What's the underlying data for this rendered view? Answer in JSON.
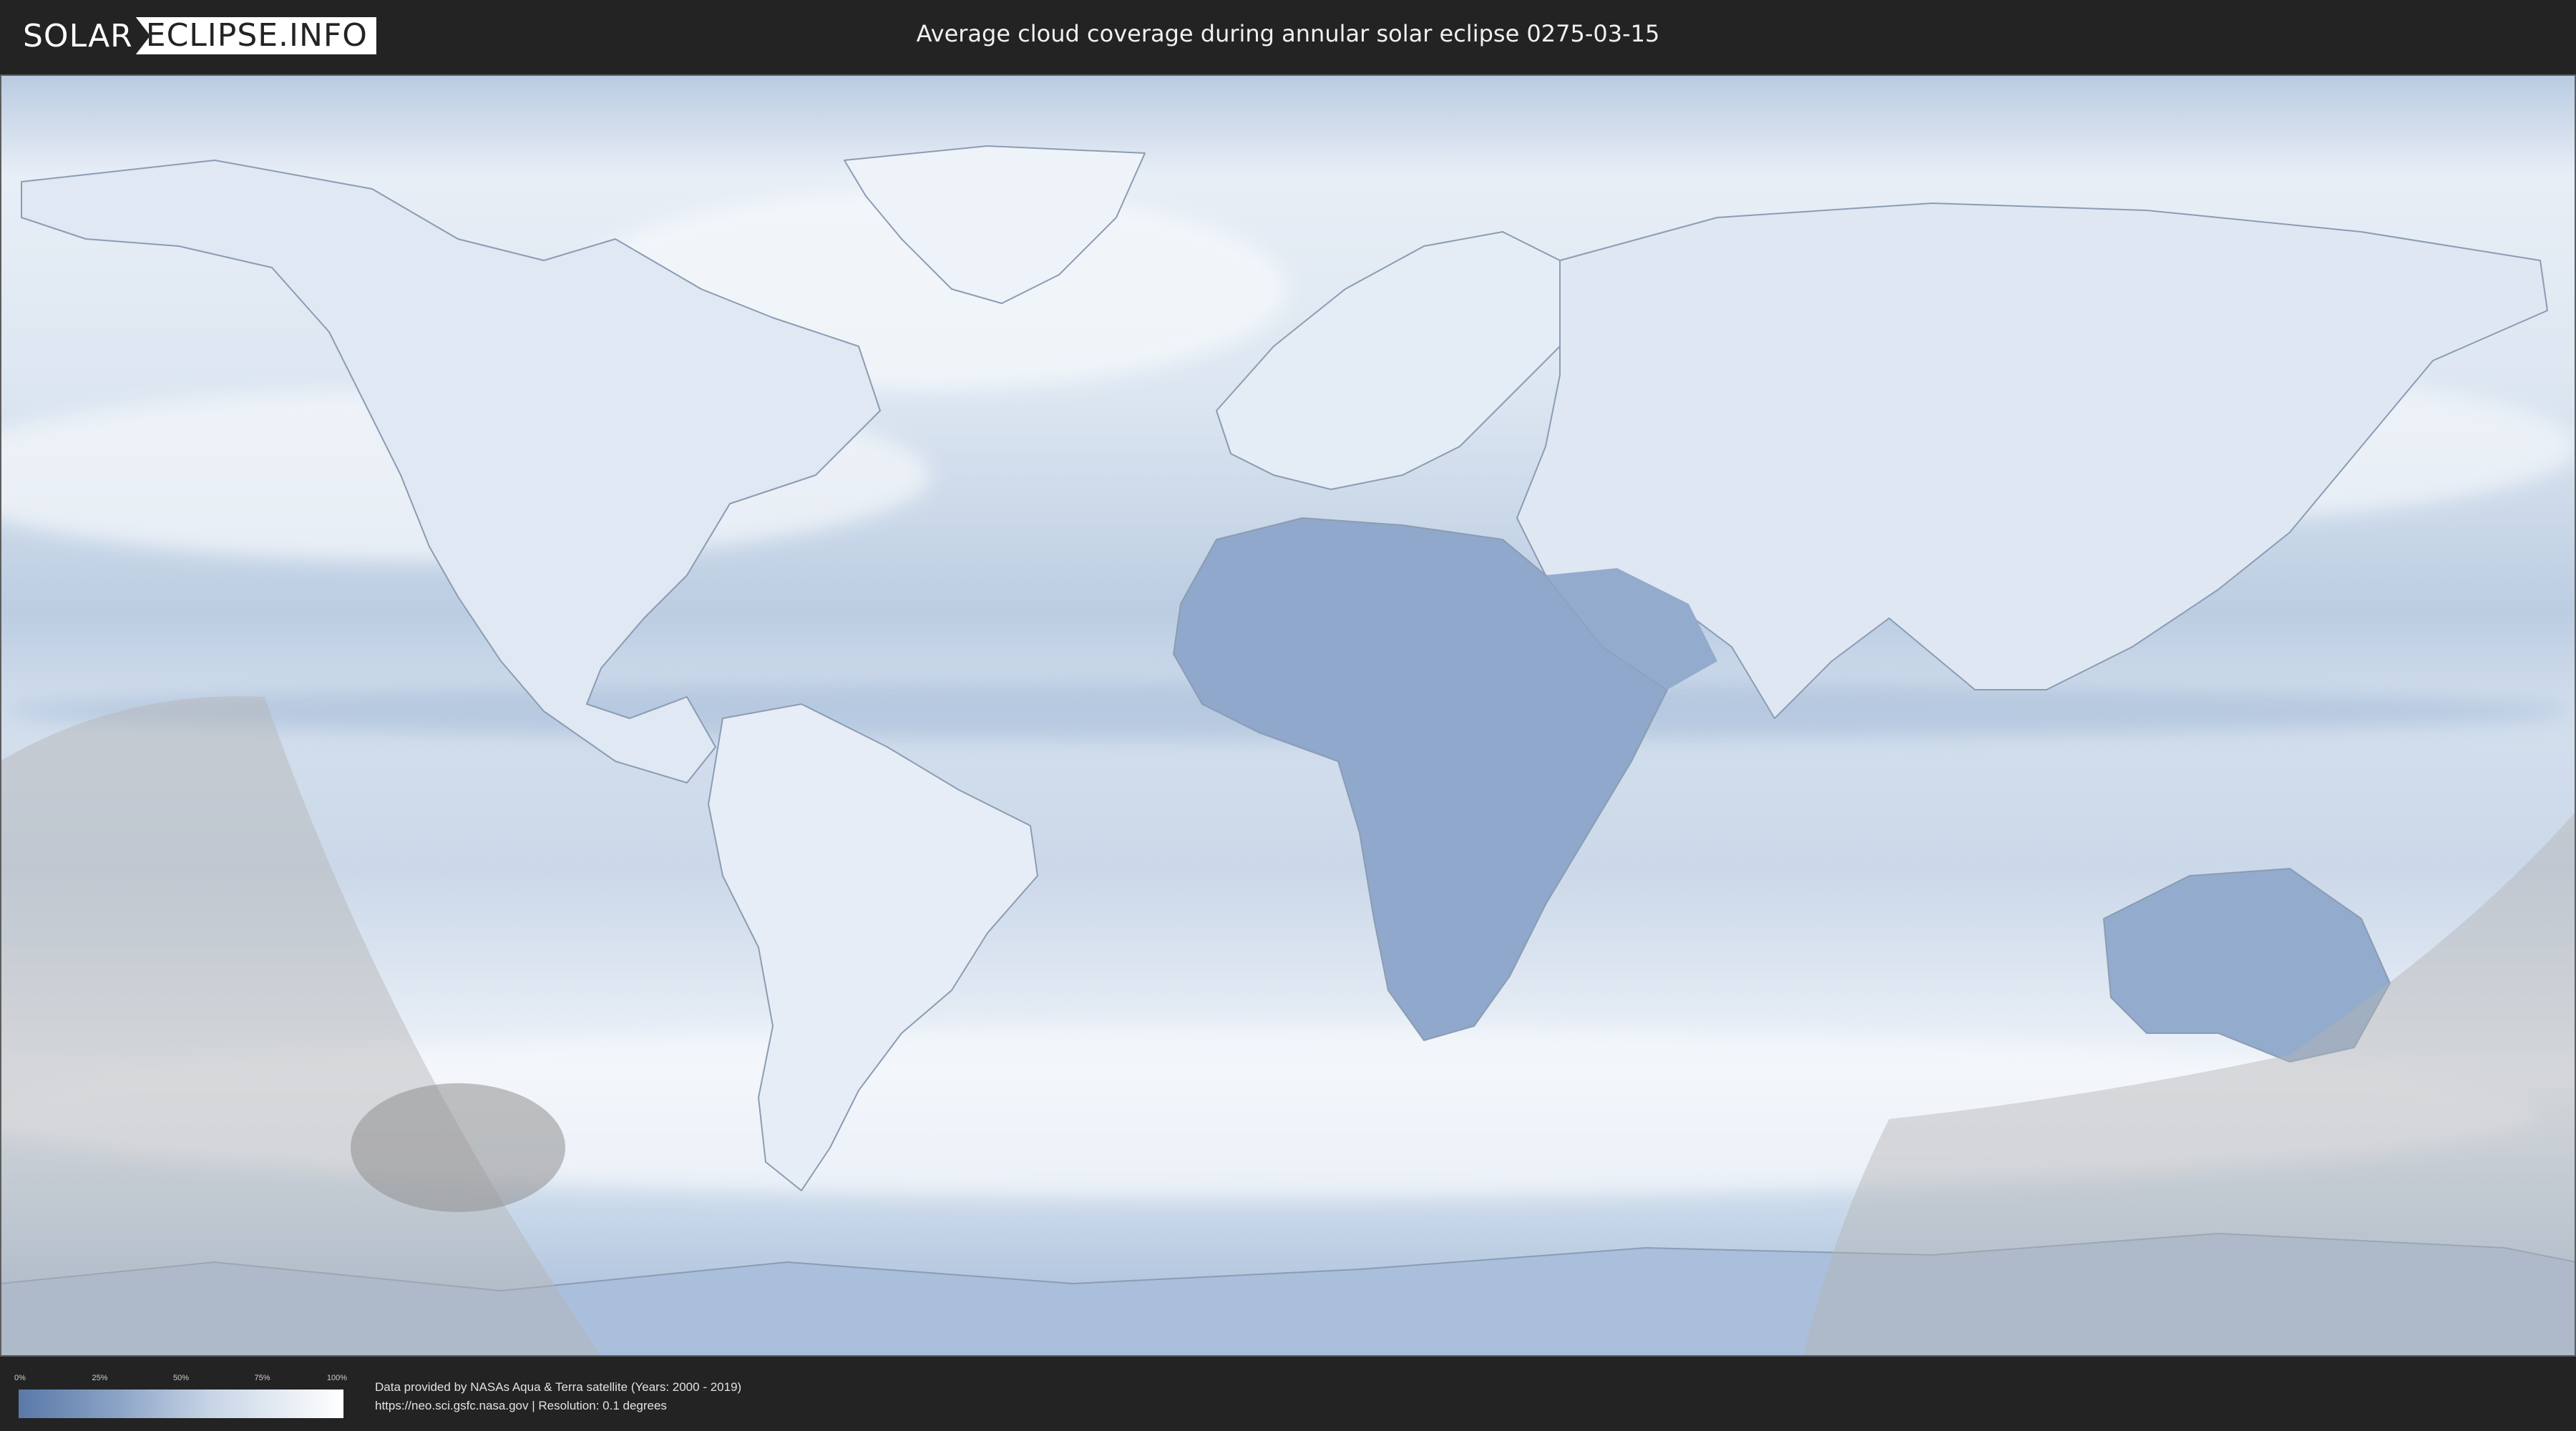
{
  "header": {
    "logo_left": "SOLAR",
    "logo_right": "ECLIPSE.INFO",
    "title": "Average cloud coverage during annular solar eclipse 0275-03-15"
  },
  "map": {
    "colors": {
      "clear_sky": "#5a79a8",
      "overcast": "#ffffff",
      "eclipse_shadow_overlay": "#b4b4b4",
      "frame": "#232323"
    },
    "layers": [
      "cloud-coverage",
      "country-borders",
      "eclipse-visibility-overlay"
    ]
  },
  "legend": {
    "ticks": [
      "0%",
      "25%",
      "50%",
      "75%",
      "100%"
    ]
  },
  "footer": {
    "credit_line1": "Data provided by NASAs Aqua & Terra satellite (Years: 2000 - 2019)",
    "credit_line2": "https://neo.sci.gsfc.nasa.gov | Resolution: 0.1 degrees"
  }
}
